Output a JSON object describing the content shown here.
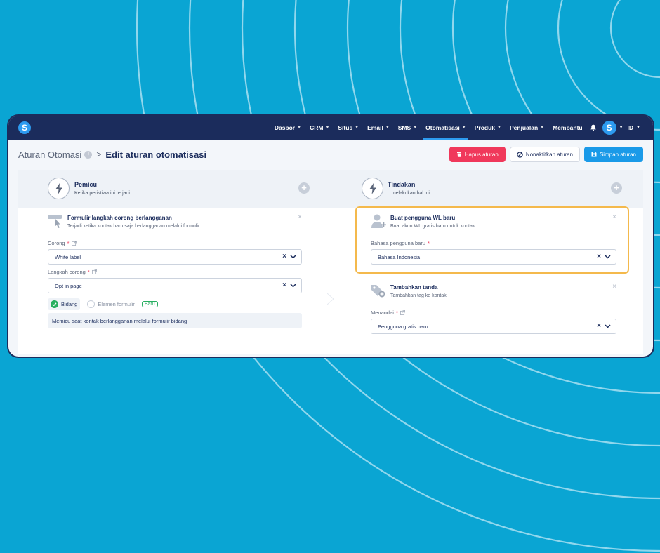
{
  "nav": {
    "logo": "S",
    "items": [
      {
        "label": "Dasbor",
        "chev": true,
        "active": false
      },
      {
        "label": "CRM",
        "chev": true,
        "active": false
      },
      {
        "label": "Situs",
        "chev": true,
        "active": false
      },
      {
        "label": "Email",
        "chev": true,
        "active": false
      },
      {
        "label": "SMS",
        "chev": true,
        "active": false
      },
      {
        "label": "Otomatisasi",
        "chev": true,
        "active": true
      },
      {
        "label": "Produk",
        "chev": true,
        "active": false
      },
      {
        "label": "Penjualan",
        "chev": true,
        "active": false
      },
      {
        "label": "Membantu",
        "chev": false,
        "active": false
      }
    ],
    "avatar": "S",
    "lang": "ID"
  },
  "breadcrumb": {
    "root": "Aturan Otomasi",
    "info": "!",
    "separator": ">",
    "current": "Edit aturan otomatisasi"
  },
  "header_buttons": {
    "delete": "Hapus aturan",
    "disable": "Nonaktifkan aturan",
    "save": "Simpan aturan"
  },
  "trigger": {
    "title": "Pemicu",
    "subtitle": "Ketika peristiwa ini terjadi..",
    "card": {
      "title": "Formulir langkah corong berlangganan",
      "subtitle": "Terjadi ketika kontak baru saja berlangganan melalui formulir",
      "funnel_label": "Corong",
      "funnel_value": "White label",
      "step_label": "Langkah corong",
      "step_value": "Opt in page",
      "option_field": "Bidang",
      "option_element": "Elemen formulir",
      "badge_new": "Baru",
      "description": "Memicu saat kontak berlangganan melalui formulir bidang"
    }
  },
  "action": {
    "title": "Tindakan",
    "subtitle": "...melakukan hal ini",
    "card1": {
      "title": "Buat pengguna WL baru",
      "subtitle": "Buat akun WL gratis baru untuk kontak",
      "lang_label": "Bahasa pengguna baru",
      "lang_value": "Bahasa Indonesia"
    },
    "card2": {
      "title": "Tambahkan tanda",
      "subtitle": "Tambahkan tag ke kontak",
      "tag_label": "Menandai",
      "tag_value": "Pengguna gratis baru"
    }
  },
  "common": {
    "required": "*",
    "clear": "×",
    "close": "×",
    "add": "+"
  },
  "colors": {
    "navbar": "#1b2c5c",
    "accent": "#1a9ae8",
    "danger": "#f0385b",
    "success": "#27ae60",
    "highlight": "#f4b94c",
    "background": "#0aa5d3"
  }
}
